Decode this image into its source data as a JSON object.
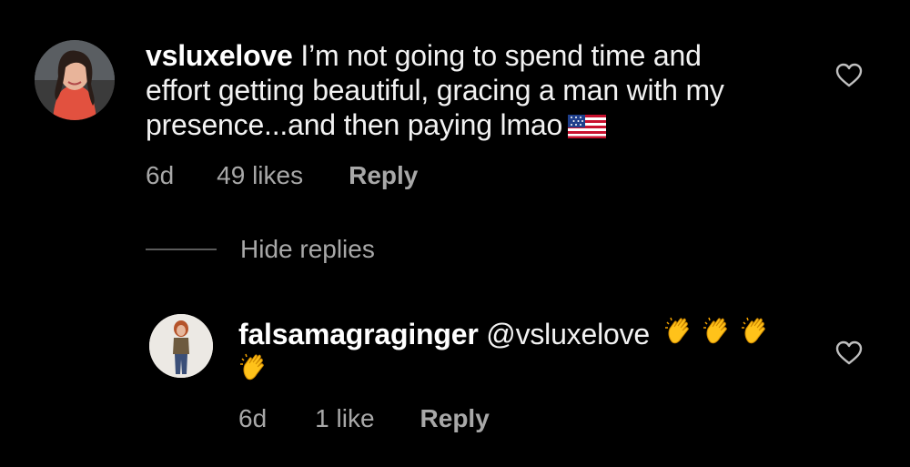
{
  "comments": [
    {
      "username": "vsluxelove",
      "text_lines": [
        "I’m not going to spend time and",
        "effort getting beautiful, gracing a man with my",
        "presence...and then paying lmao"
      ],
      "emoji": "us-flag",
      "age": "6d",
      "likes": "49 likes",
      "reply_label": "Reply"
    }
  ],
  "hide_replies_label": "Hide replies",
  "replies": [
    {
      "username": "falsamagraginger",
      "mention": "@vsluxelove",
      "emoji": "clapping-hands",
      "age": "6d",
      "likes": "1 like",
      "reply_label": "Reply"
    }
  ],
  "colors": {
    "background": "#000000",
    "text": "#f2f2f2",
    "meta": "#a8a8a8"
  },
  "icons": [
    "heart-icon",
    "us-flag-emoji",
    "clapping-hands-emoji"
  ]
}
